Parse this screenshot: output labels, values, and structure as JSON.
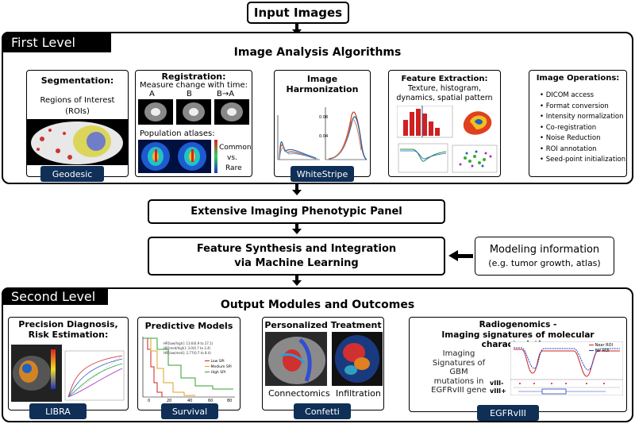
{
  "input_images": "Input Images",
  "first_level": {
    "label": "First Level",
    "title": "Image Analysis Algorithms",
    "panels": {
      "segmentation": {
        "title": "Segmentation:",
        "line1": "Regions of Interest",
        "line2": "(ROIs)",
        "tag": "Geodesic"
      },
      "registration": {
        "title": "Registration:",
        "subtitle": "Measure change with time:",
        "col_a": "A",
        "col_b": "B",
        "col_ba": "B→A",
        "atlas": "Population atlases:",
        "common": "Common",
        "vs": "vs.",
        "rare": "Rare"
      },
      "harmonization": {
        "title_1": "Image",
        "title_2": "Harmonization",
        "tag": "WhiteStripe"
      },
      "feature_extraction": {
        "title": "Feature Extraction:",
        "line1": "Texture, histogram,",
        "line2": "dynamics, spatial pattern"
      },
      "image_operations": {
        "title": "Image Operations:",
        "items": [
          "DICOM access",
          "Format conversion",
          "Intensity normalization",
          "Co-registration",
          "Noise Reduction",
          "ROI annotation",
          "Seed-point initialization"
        ]
      }
    }
  },
  "phenotypic_panel": "Extensive Imaging Phenotypic Panel",
  "synthesis": {
    "line1": "Feature Synthesis and Integration",
    "line2": "via Machine Learning"
  },
  "modeling": {
    "line1": "Modeling information",
    "line2": "(e.g. tumor growth, atlas)"
  },
  "second_level": {
    "label": "Second Level",
    "title": "Output Modules and Outcomes",
    "panels": {
      "precision": {
        "title_1": "Precision Diagnosis,",
        "title_2": "Risk Estimation:",
        "tag": "LIBRA"
      },
      "predictive": {
        "title": "Predictive Models",
        "legend": [
          "Low SPI",
          "Medium SPI",
          "High SPI"
        ],
        "tag": "Survival"
      },
      "personalized": {
        "title": "Personalized Treatment",
        "cap1": "Connectomics",
        "cap2": "Infiltration",
        "tag": "Confetti"
      },
      "radiogenomics": {
        "title_1": "Radiogenomics -",
        "title_2": "Imaging signatures of molecular characteristics:",
        "desc": [
          "Imaging",
          "Signatures of",
          "GBM",
          "mutations in",
          "EGFRvIII gene"
        ],
        "legend": [
          "Near ROI",
          "Far ROI"
        ],
        "row1": "vIII-",
        "row2": "vIII+",
        "tag": "EGFRvIII"
      }
    }
  },
  "colors": {
    "tag_bg": "#0f2f57",
    "header_bg": "#000000"
  }
}
